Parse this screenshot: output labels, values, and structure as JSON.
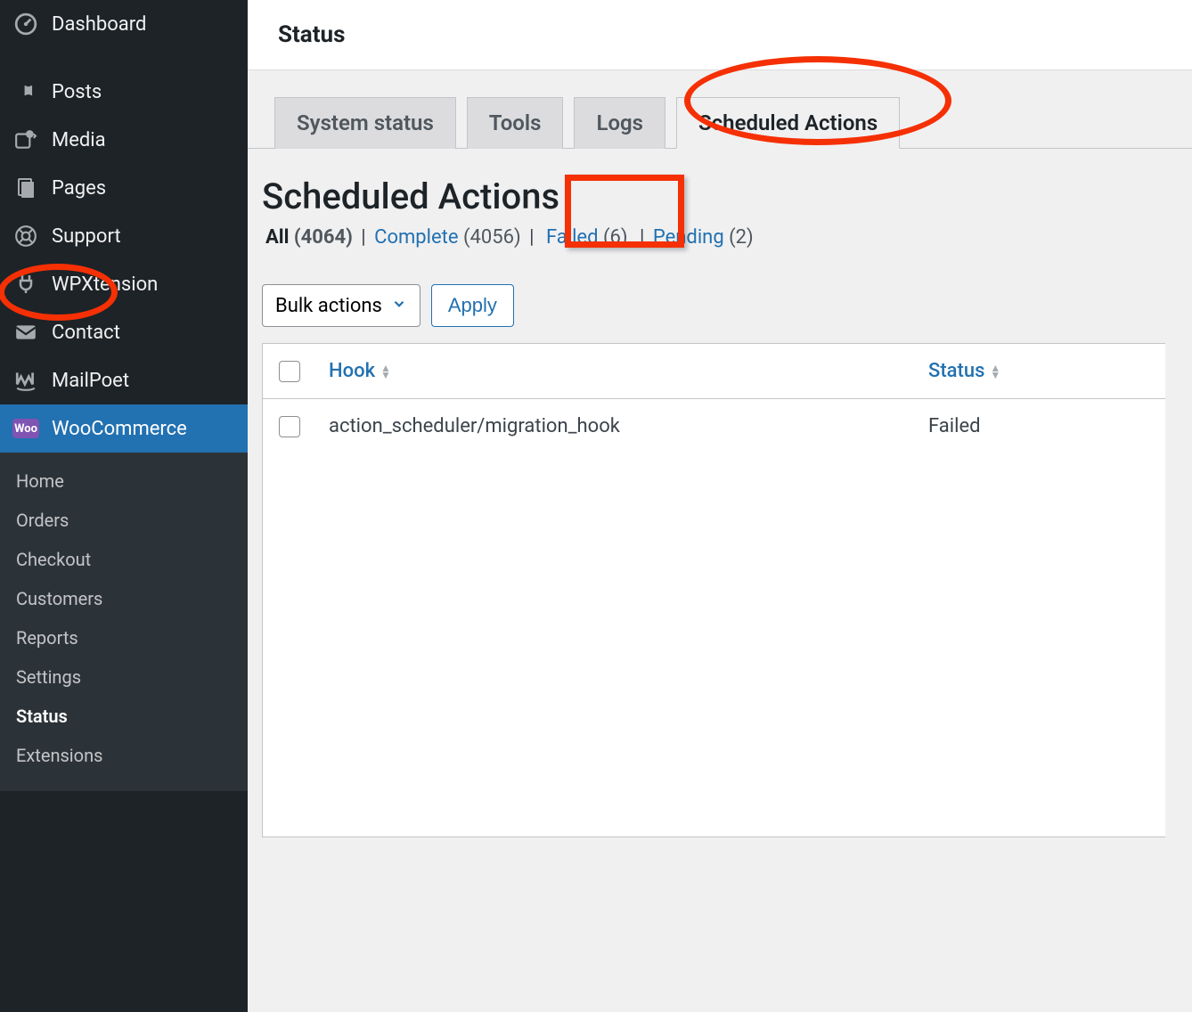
{
  "sidebar": {
    "main_items": [
      {
        "name": "dashboard",
        "label": "Dashboard"
      },
      {
        "name": "posts",
        "label": "Posts"
      },
      {
        "name": "media",
        "label": "Media"
      },
      {
        "name": "pages",
        "label": "Pages"
      },
      {
        "name": "support",
        "label": "Support"
      },
      {
        "name": "wpxtension",
        "label": "WPXtension"
      },
      {
        "name": "contact",
        "label": "Contact"
      },
      {
        "name": "mailpoet",
        "label": "MailPoet"
      },
      {
        "name": "woocommerce",
        "label": "WooCommerce",
        "woo_badge": "Woo"
      }
    ],
    "sub_items": [
      {
        "name": "home",
        "label": "Home"
      },
      {
        "name": "orders",
        "label": "Orders"
      },
      {
        "name": "checkout",
        "label": "Checkout"
      },
      {
        "name": "customers",
        "label": "Customers"
      },
      {
        "name": "reports",
        "label": "Reports"
      },
      {
        "name": "settings",
        "label": "Settings"
      },
      {
        "name": "status",
        "label": "Status"
      },
      {
        "name": "extensions",
        "label": "Extensions"
      }
    ]
  },
  "topbar": {
    "title": "Status"
  },
  "tabs": [
    {
      "name": "system-status",
      "label": "System status"
    },
    {
      "name": "tools",
      "label": "Tools"
    },
    {
      "name": "logs",
      "label": "Logs"
    },
    {
      "name": "scheduled-actions",
      "label": "Scheduled Actions"
    }
  ],
  "page": {
    "heading": "Scheduled Actions",
    "filters": {
      "all": {
        "label": "All",
        "count": "(4064)"
      },
      "complete": {
        "label": "Complete",
        "count": "(4056)"
      },
      "failed": {
        "label": "Failed",
        "count": "(6)"
      },
      "pending": {
        "label": "Pending",
        "count": "(2)"
      }
    },
    "bulk_label": "Bulk actions",
    "apply_label": "Apply",
    "columns": {
      "hook": "Hook",
      "status": "Status"
    },
    "rows": [
      {
        "hook": "action_scheduler/migration_hook",
        "status": "Failed"
      }
    ]
  }
}
